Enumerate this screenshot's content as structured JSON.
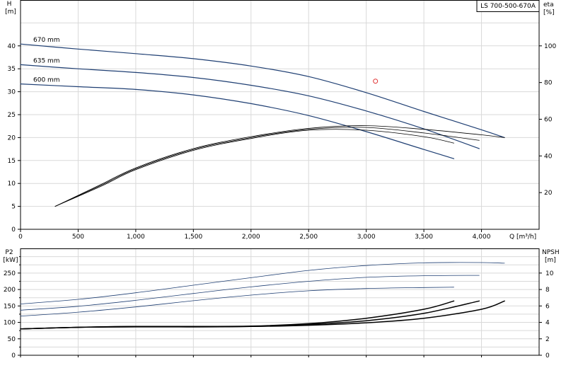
{
  "chart_data": [
    {
      "type": "line",
      "title": "LS 700-500-670A",
      "x_axis": {
        "label": "Q [m³/h]",
        "range": [
          0,
          4500
        ],
        "ticks": [
          0,
          500,
          1000,
          1500,
          2000,
          2500,
          3000,
          3500,
          4000
        ],
        "tick_labels": [
          "0",
          "500",
          "1,000",
          "1,500",
          "2,000",
          "2,500",
          "3,000",
          "3,500",
          "4,000"
        ]
      },
      "y_axis_left": {
        "label_top": "H",
        "label_bottom": "[m]",
        "range": [
          0,
          50
        ],
        "ticks": [
          0,
          5,
          10,
          15,
          20,
          25,
          30,
          35,
          40
        ]
      },
      "y_axis_right": {
        "label_top": "eta",
        "label_bottom": "[%]",
        "range": [
          0,
          125
        ],
        "ticks": [
          20,
          40,
          60,
          80,
          100
        ]
      },
      "grid": true,
      "series": [
        {
          "name": "670 mm",
          "axis": "left",
          "color": "#1f3f73",
          "x": [
            0,
            500,
            1000,
            1500,
            2000,
            2500,
            3000,
            3500,
            4000,
            4200
          ],
          "y": [
            40.4,
            39.3,
            38.3,
            37.2,
            35.6,
            33.3,
            29.8,
            25.7,
            21.7,
            20.0
          ]
        },
        {
          "name": "635 mm",
          "axis": "left",
          "color": "#1f3f73",
          "x": [
            0,
            500,
            1000,
            1500,
            2000,
            2500,
            3000,
            3500,
            3980
          ],
          "y": [
            35.9,
            35.0,
            34.2,
            33.1,
            31.4,
            29.1,
            25.8,
            21.9,
            17.6
          ]
        },
        {
          "name": "600 mm",
          "axis": "left",
          "color": "#1f3f73",
          "x": [
            0,
            500,
            1000,
            1500,
            2000,
            2500,
            3000,
            3500,
            3760
          ],
          "y": [
            31.7,
            31.1,
            30.5,
            29.3,
            27.4,
            24.8,
            21.3,
            17.4,
            15.4
          ]
        },
        {
          "name": "",
          "axis": "right",
          "color": "#000000",
          "x": [
            300,
            700,
            1000,
            1500,
            2000,
            2500,
            3000,
            3500,
            4000,
            4200
          ],
          "y": [
            12.5,
            24.5,
            33.5,
            44.0,
            50.5,
            55.0,
            56.5,
            54.5,
            51.5,
            50.0
          ]
        },
        {
          "name": "",
          "axis": "right",
          "color": "#000000",
          "x": [
            300,
            700,
            1000,
            1500,
            2000,
            2500,
            3000,
            3500,
            3980
          ],
          "y": [
            12.5,
            24.0,
            33.0,
            43.5,
            50.0,
            54.5,
            55.5,
            52.5,
            48.5
          ]
        },
        {
          "name": "",
          "axis": "right",
          "color": "#000000",
          "x": [
            300,
            700,
            1000,
            1500,
            2000,
            2500,
            3000,
            3500,
            3760
          ],
          "y": [
            12.5,
            23.5,
            32.5,
            43.0,
            49.5,
            54.0,
            54.0,
            50.5,
            47.0
          ]
        }
      ],
      "annotations": [
        {
          "text": "670 mm"
        },
        {
          "text": "635 mm"
        },
        {
          "text": "600 mm"
        }
      ],
      "duty_point": {
        "x": 3080,
        "y": 32.3
      }
    },
    {
      "type": "line",
      "x_axis": {
        "range": [
          0,
          4500
        ]
      },
      "y_axis_left": {
        "label_top": "P2",
        "label_bottom": "[kW]",
        "range": [
          0,
          325
        ],
        "ticks": [
          0,
          25,
          50,
          75,
          100,
          125,
          150,
          175,
          200,
          225,
          250,
          275,
          300
        ],
        "tick_labels": [
          "0",
          "50",
          "100",
          "150",
          "200",
          "250"
        ],
        "labeled_ticks": [
          0,
          50,
          100,
          150,
          200,
          250
        ]
      },
      "y_axis_right": {
        "label_top": "NPSH",
        "label_bottom": "[m]",
        "range": [
          0,
          13
        ],
        "ticks": [
          0,
          2,
          4,
          6,
          8,
          10
        ]
      },
      "grid": true,
      "series": [
        {
          "name": "",
          "axis": "left",
          "color": "#1f3f73",
          "x": [
            0,
            500,
            1000,
            1500,
            2000,
            2500,
            3000,
            3500,
            4000,
            4200
          ],
          "y": [
            156,
            170,
            190,
            213,
            236,
            258,
            273,
            281,
            282,
            280
          ]
        },
        {
          "name": "",
          "axis": "left",
          "color": "#1f3f73",
          "x": [
            0,
            500,
            1000,
            1500,
            2000,
            2500,
            3000,
            3500,
            3980
          ],
          "y": [
            137,
            149,
            167,
            188,
            208,
            225,
            237,
            242,
            243
          ]
        },
        {
          "name": "",
          "axis": "left",
          "color": "#1f3f73",
          "x": [
            0,
            500,
            1000,
            1500,
            2000,
            2500,
            3000,
            3500,
            3760
          ],
          "y": [
            119,
            131,
            147,
            166,
            183,
            196,
            203,
            206,
            207
          ]
        },
        {
          "name": "",
          "axis": "right",
          "color": "#000000",
          "x": [
            0,
            500,
            1000,
            1500,
            2000,
            2500,
            3000,
            3500,
            4000,
            4200
          ],
          "y": [
            3.2,
            3.4,
            3.45,
            3.45,
            3.5,
            3.65,
            3.95,
            4.5,
            5.6,
            6.6
          ]
        },
        {
          "name": "",
          "axis": "right",
          "color": "#000000",
          "x": [
            0,
            500,
            1000,
            1500,
            2000,
            2500,
            3000,
            3500,
            3980
          ],
          "y": [
            3.2,
            3.4,
            3.5,
            3.45,
            3.5,
            3.75,
            4.2,
            5.1,
            6.6
          ]
        },
        {
          "name": "",
          "axis": "right",
          "color": "#000000",
          "x": [
            0,
            500,
            1000,
            1500,
            2000,
            2500,
            3000,
            3500,
            3760
          ],
          "y": [
            3.2,
            3.4,
            3.5,
            3.5,
            3.55,
            3.85,
            4.5,
            5.6,
            6.6
          ]
        }
      ]
    }
  ]
}
